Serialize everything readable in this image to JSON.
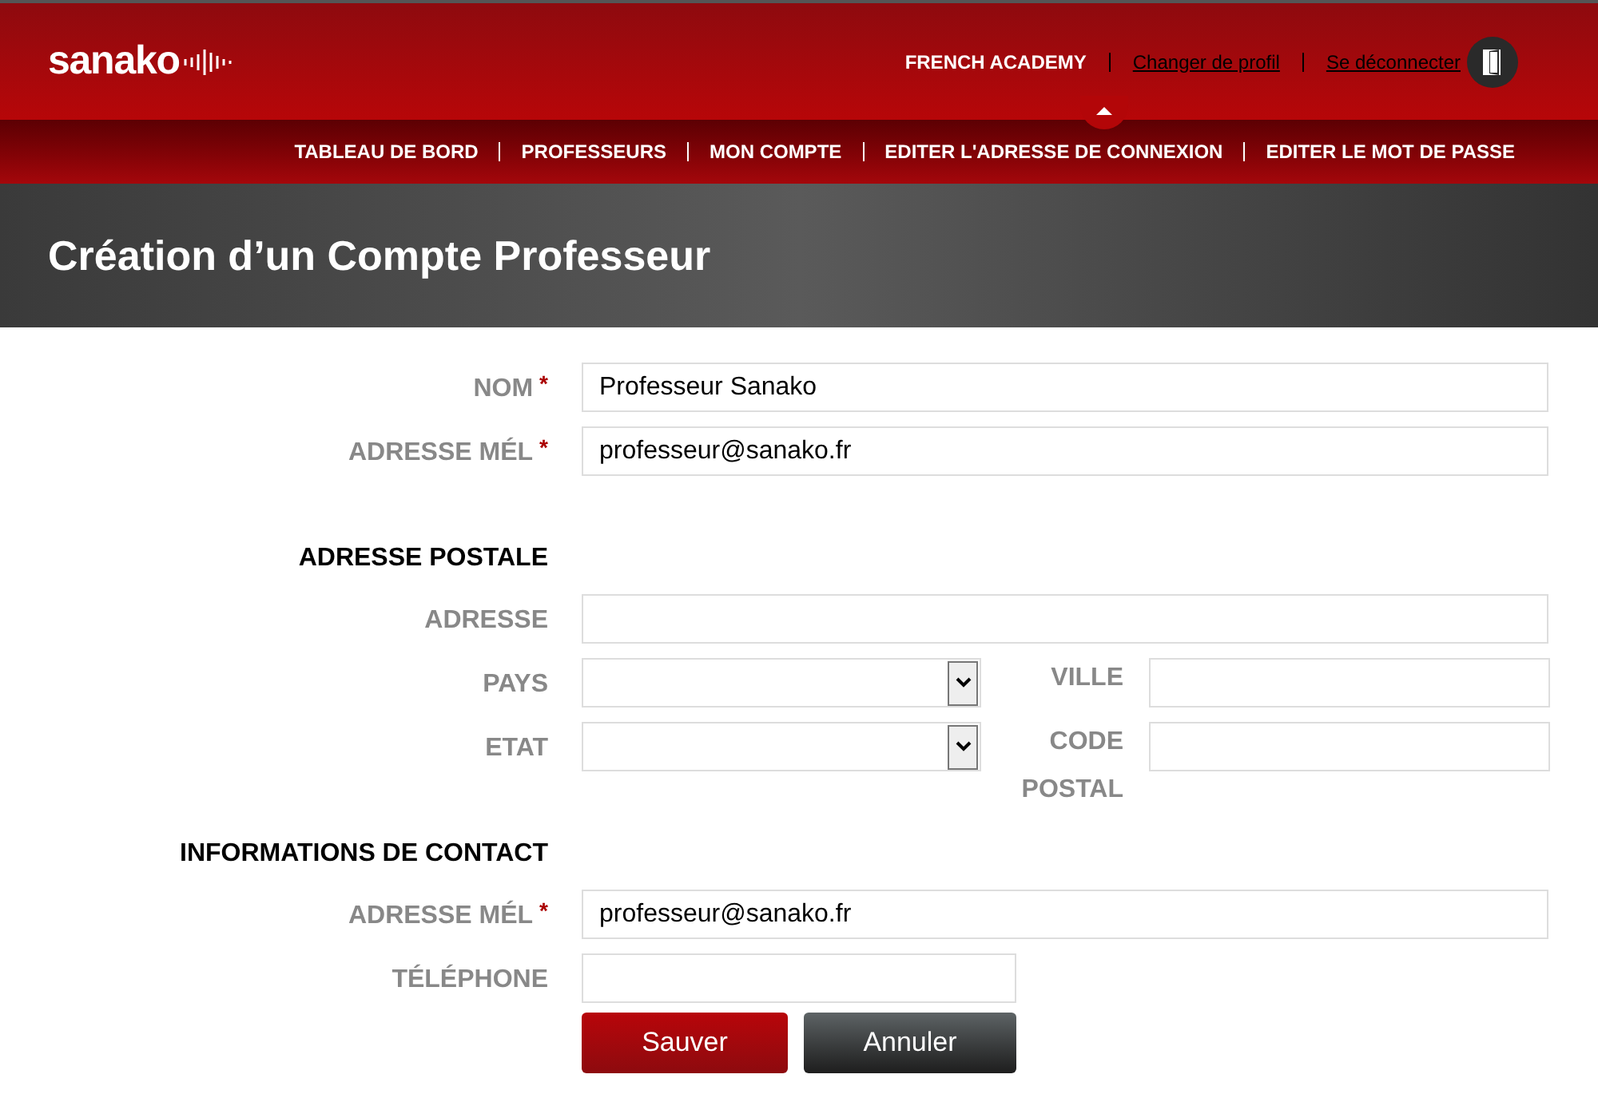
{
  "header": {
    "logo": "sanako",
    "school": "FRENCH ACADEMY",
    "links": [
      "Changer de profil",
      "Se déconnecter"
    ]
  },
  "nav": [
    "TABLEAU DE BORD",
    "PROFESSEURS",
    "MON COMPTE",
    "EDITER L'ADRESSE DE CONNEXION",
    "EDITER LE MOT DE PASSE"
  ],
  "page_title": "Création d’un Compte Professeur",
  "form": [
    {
      "kind": "field",
      "label": "NOM",
      "required": "*",
      "value": "Professeur Sanako"
    },
    {
      "kind": "field",
      "label": "ADRESSE MÉL",
      "required": "*",
      "value": "professeur@sanako.fr"
    },
    {
      "kind": "section",
      "label": "ADRESSE POSTALE"
    },
    {
      "kind": "field",
      "label": "ADRESSE"
    },
    {
      "kind": "pair",
      "label": "PAYS",
      "second_label": "VILLE"
    },
    {
      "kind": "pair",
      "label": "ETAT",
      "second_label": "CODE POSTAL"
    },
    {
      "kind": "section",
      "label": "INFORMATIONS DE CONTACT"
    },
    {
      "kind": "field",
      "label": "ADRESSE MÉL",
      "required": "*",
      "value": "professeur@sanako.fr"
    },
    {
      "kind": "short_field",
      "label": "TÉLÉPHONE"
    }
  ],
  "buttons": [
    {
      "label": "Sauver",
      "kind": "primary"
    },
    {
      "label": "Annuler",
      "kind": "secondary"
    }
  ]
}
